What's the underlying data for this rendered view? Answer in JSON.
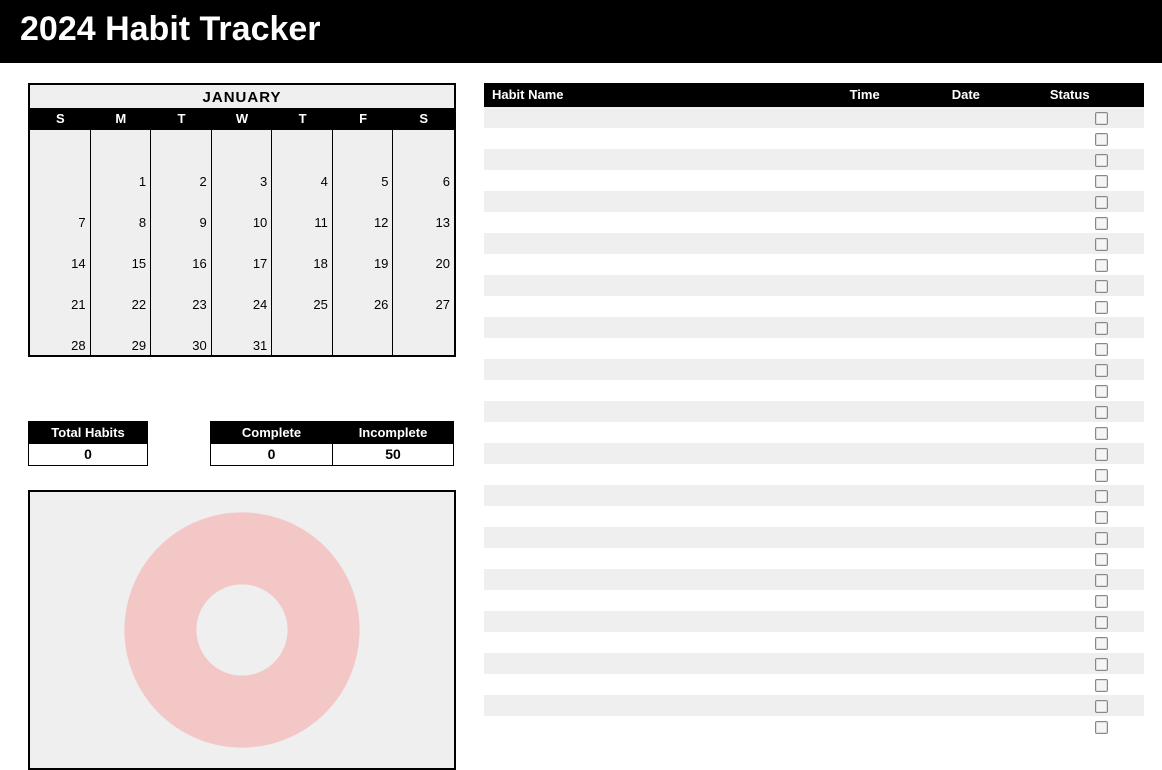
{
  "title": "2024 Habit Tracker",
  "calendar": {
    "month": "JANUARY",
    "weekdays": [
      "S",
      "M",
      "T",
      "W",
      "T",
      "F",
      "S"
    ],
    "grid": [
      [
        "",
        "",
        "",
        "",
        "",
        "",
        ""
      ],
      [
        "",
        "1",
        "2",
        "3",
        "4",
        "5",
        "6"
      ],
      [
        "7",
        "8",
        "9",
        "10",
        "11",
        "12",
        "13"
      ],
      [
        "14",
        "15",
        "16",
        "17",
        "18",
        "19",
        "20"
      ],
      [
        "21",
        "22",
        "23",
        "24",
        "25",
        "26",
        "27"
      ],
      [
        "28",
        "29",
        "30",
        "31",
        "",
        "",
        ""
      ]
    ]
  },
  "stats": {
    "total_label": "Total Habits",
    "total_value": "0",
    "complete_label": "Complete",
    "complete_value": "0",
    "incomplete_label": "Incomplete",
    "incomplete_value": "50"
  },
  "chart_data": {
    "type": "pie",
    "title": "",
    "series": [
      {
        "name": "Complete",
        "value": 0,
        "color": "#8fbf8f"
      },
      {
        "name": "Incomplete",
        "value": 50,
        "color": "#f4c7c7"
      }
    ]
  },
  "habit_table": {
    "headers": {
      "name": "Habit Name",
      "time": "Time",
      "date": "Date",
      "status": "Status"
    },
    "row_count": 30
  }
}
